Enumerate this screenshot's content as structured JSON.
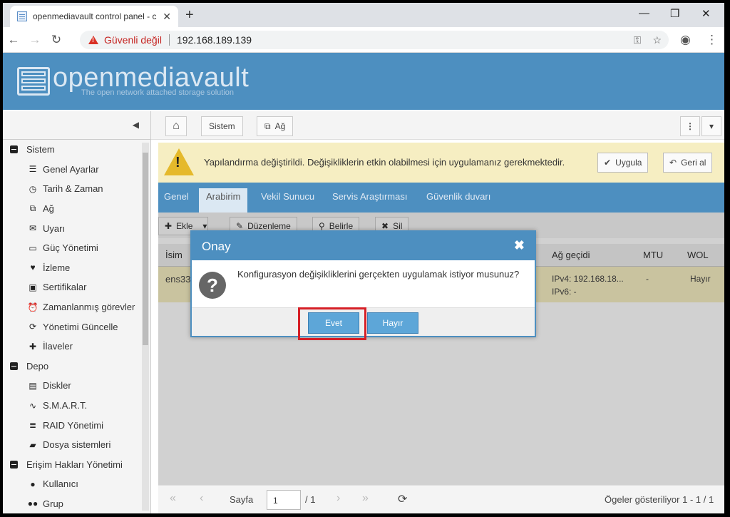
{
  "browser": {
    "tab_title": "openmediavault control panel - c",
    "tab_close": "✕",
    "new_tab": "+",
    "insecure_label": "Güvenli değil",
    "url": "192.168.189.139",
    "min": "—",
    "max": "❐",
    "close": "✕"
  },
  "banner": {
    "logo_text": "openmediavault",
    "tagline": "The open network attached storage solution"
  },
  "sidebar": {
    "collapse_arrow": "◀",
    "items": [
      {
        "label": "Sistem",
        "type": "group"
      },
      {
        "label": "Genel Ayarlar",
        "icon": "☰",
        "type": "child"
      },
      {
        "label": "Tarih & Zaman",
        "icon": "◷",
        "type": "child"
      },
      {
        "label": "Ağ",
        "icon": "⧉",
        "type": "child"
      },
      {
        "label": "Uyarı",
        "icon": "✉",
        "type": "child"
      },
      {
        "label": "Güç Yönetimi",
        "icon": "▭",
        "type": "child"
      },
      {
        "label": "İzleme",
        "icon": "♥",
        "type": "child"
      },
      {
        "label": "Sertifikalar",
        "icon": "▣",
        "type": "child"
      },
      {
        "label": "Zamanlanmış görevler",
        "icon": "⏰",
        "type": "child"
      },
      {
        "label": "Yönetimi Güncelle",
        "icon": "⟳",
        "type": "child"
      },
      {
        "label": "İlaveler",
        "icon": "✚",
        "type": "child"
      },
      {
        "label": "Depo",
        "type": "group"
      },
      {
        "label": "Diskler",
        "icon": "▤",
        "type": "child"
      },
      {
        "label": "S.M.A.R.T.",
        "icon": "∿",
        "type": "child"
      },
      {
        "label": "RAID Yönetimi",
        "icon": "≣",
        "type": "child"
      },
      {
        "label": "Dosya sistemleri",
        "icon": "▰",
        "type": "child"
      },
      {
        "label": "Erişim Hakları Yönetimi",
        "type": "group"
      },
      {
        "label": "Kullanıcı",
        "icon": "●",
        "type": "child"
      },
      {
        "label": "Grup",
        "icon": "●●",
        "type": "child"
      }
    ]
  },
  "breadcrumb": {
    "home_icon": "⌂",
    "sistem": "Sistem",
    "ag": "Ağ",
    "ag_icon": "⧉",
    "menu_icon": "⋮",
    "dropdown_icon": "▾"
  },
  "alert": {
    "message": "Yapılandırma değiştirildi. Değişikliklerin etkin olabilmesi için uygulamanız gerekmektedir.",
    "apply": "Uygula",
    "revert": "Geri al"
  },
  "tabs": [
    "Genel",
    "Arabirim",
    "Vekil Sunucu",
    "Servis Araştırması",
    "Güvenlik duvarı"
  ],
  "grid_toolbar": {
    "add": "Ekle",
    "edit": "Düzenleme",
    "details": "Belirle",
    "delete": "Sil"
  },
  "grid": {
    "columns": [
      "İsim",
      "Ağ geçidi",
      "MTU",
      "WOL"
    ],
    "row": {
      "name": "ens33",
      "gateway_v4": "IPv4: 192.168.18...",
      "gateway_v6": "IPv6: -",
      "mtu": "-",
      "wol": "Hayır"
    }
  },
  "pager": {
    "first": "«",
    "prev": "‹",
    "page_label": "Sayfa",
    "page_value": "1",
    "of": "/ 1",
    "next": "›",
    "last": "»",
    "refresh": "⟳",
    "summary": "Ögeler gösteriliyor 1 - 1 / 1"
  },
  "dialog": {
    "title": "Onay",
    "message": "Konfigurasyon değişikliklerini gerçekten uygulamak istiyor musunuz?",
    "yes": "Evet",
    "no": "Hayır"
  }
}
